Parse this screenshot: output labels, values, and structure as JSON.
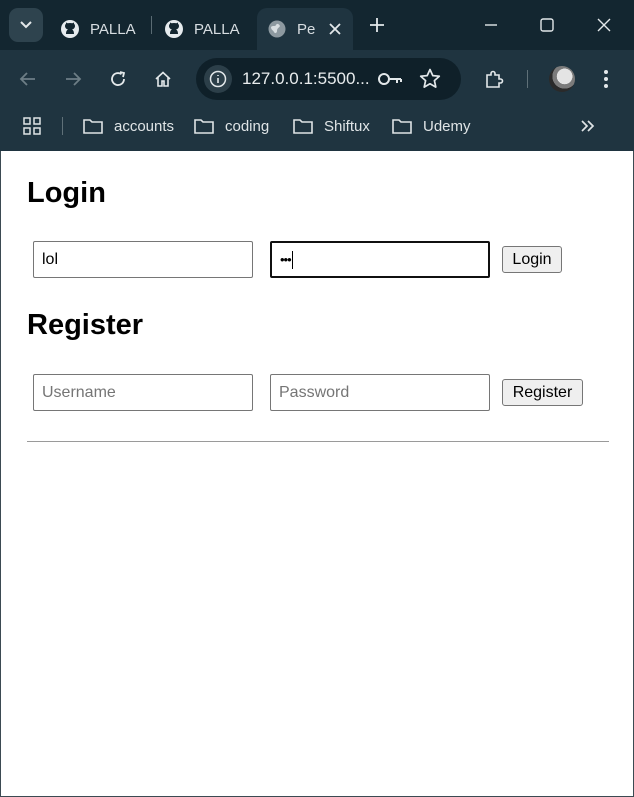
{
  "browser": {
    "tabs": [
      {
        "label": "PALLA",
        "icon": "github-icon",
        "active": false
      },
      {
        "label": "PALLA",
        "icon": "github-icon",
        "active": false
      },
      {
        "label": "Pe",
        "icon": "globe-icon",
        "active": true
      }
    ],
    "address": "127.0.0.1:5500...",
    "bookmarks": [
      "accounts",
      "coding",
      "Shiftux",
      "Udemy"
    ]
  },
  "login": {
    "heading": "Login",
    "username_value": "lol",
    "password_mask": "•••",
    "button_label": "Login"
  },
  "register": {
    "heading": "Register",
    "username_placeholder": "Username",
    "password_placeholder": "Password",
    "button_label": "Register"
  }
}
